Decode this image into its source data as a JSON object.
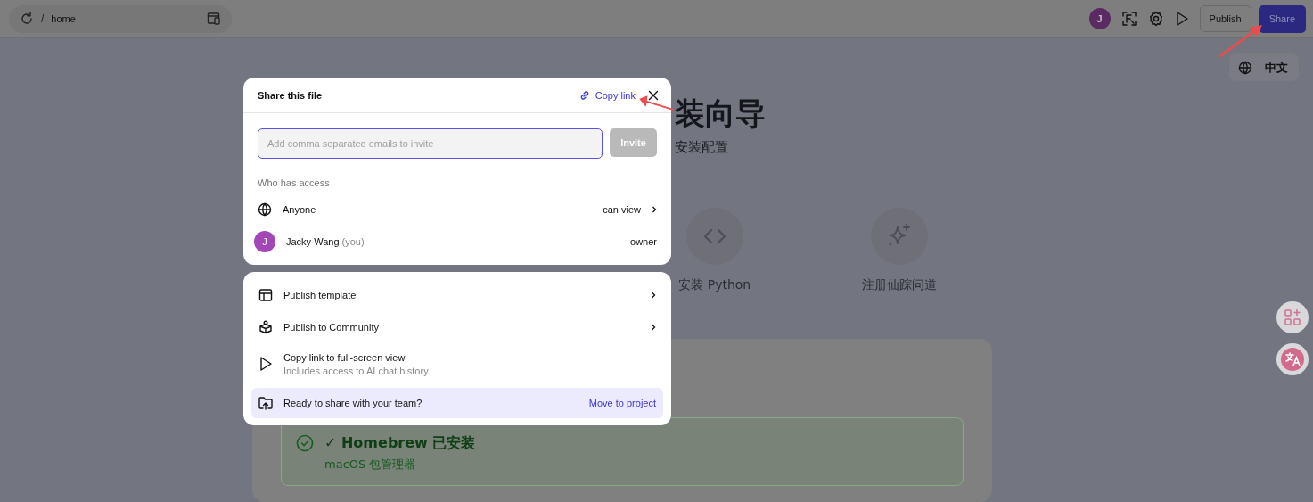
{
  "top_bar": {
    "separator": "/",
    "page": "home",
    "avatar_initial": "J",
    "publish_button": "Publish",
    "share_button": "Share"
  },
  "language_button": {
    "label": "中文"
  },
  "page": {
    "title_fragment": "装向导",
    "subtitle_fragment": "安装配置",
    "steps": [
      {
        "kind": "code",
        "label": "安装 Python"
      },
      {
        "kind": "sparkle",
        "label": "注册仙踪问道"
      }
    ],
    "status_card": {
      "title": "✓ Homebrew 已安装",
      "subtitle": "macOS 包管理器"
    }
  },
  "share_dialog": {
    "title": "Share this file",
    "copy_link": "Copy link",
    "email_field": {
      "placeholder": "Add comma separated emails to invite"
    },
    "invite_button": {
      "label": "Invite",
      "disabled": true
    },
    "access_heading": "Who has access",
    "access": [
      {
        "kind": "public",
        "name": "Anyone",
        "role": "can view",
        "has_menu": true
      },
      {
        "kind": "user",
        "initial": "J",
        "name": "Jacky Wang",
        "note": "(you)",
        "role": "owner",
        "has_menu": false
      }
    ]
  },
  "share_menu": {
    "items": [
      {
        "kind": "template",
        "label": "Publish template",
        "has_submenu": true
      },
      {
        "kind": "community",
        "label": "Publish to Community",
        "has_submenu": true
      },
      {
        "kind": "fullscreen",
        "label": "Copy link to full-screen view",
        "description": "Includes access to AI chat history",
        "has_submenu": false
      }
    ],
    "banner": {
      "text": "Ready to share with your team?",
      "action": "Move to project"
    }
  }
}
